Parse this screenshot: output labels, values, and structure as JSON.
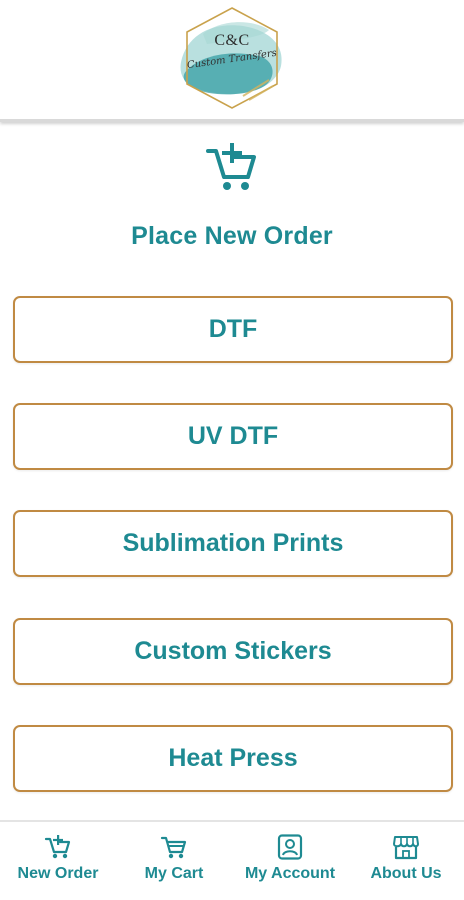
{
  "colors": {
    "accent": "#1e8a92",
    "border": "#c08a43"
  },
  "header": {
    "logo_main": "C&C",
    "logo_sub": "Custom Transfers",
    "logo_icon": "brand-logo"
  },
  "hero": {
    "icon": "add-to-cart-icon",
    "title": "Place New Order"
  },
  "options": [
    {
      "label": "DTF"
    },
    {
      "label": "UV DTF"
    },
    {
      "label": "Sublimation Prints"
    },
    {
      "label": "Custom Stickers"
    },
    {
      "label": "Heat Press"
    }
  ],
  "tabbar": [
    {
      "label": "New Order",
      "icon": "add-cart-icon"
    },
    {
      "label": "My Cart",
      "icon": "cart-icon"
    },
    {
      "label": "My Account",
      "icon": "account-icon"
    },
    {
      "label": "About Us",
      "icon": "store-icon"
    }
  ]
}
